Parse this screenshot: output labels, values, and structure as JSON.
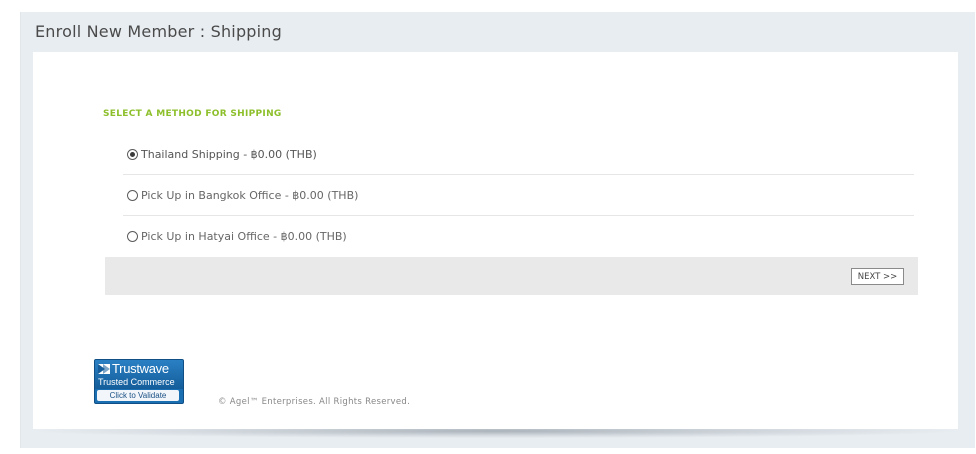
{
  "header": {
    "title": "Enroll New Member : Shipping"
  },
  "shipping": {
    "heading": "SELECT A METHOD FOR SHIPPING",
    "options": [
      {
        "label": "Thailand Shipping - ฿0.00 (THB)",
        "selected": true
      },
      {
        "label": "Pick Up in Bangkok Office - ฿0.00 (THB)",
        "selected": false
      },
      {
        "label": "Pick Up in Hatyai Office - ฿0.00 (THB)",
        "selected": false
      }
    ],
    "next_label": "NEXT >>"
  },
  "trust_badge": {
    "name": "Trustwave",
    "subtitle": "Trusted Commerce",
    "validate_label": "Click to Validate"
  },
  "footer": {
    "copyright": "© Agel™ Enterprises. All Rights Reserved."
  },
  "colors": {
    "heading_green": "#8cbf2a",
    "badge_blue": "#1a6fb3",
    "page_bg": "#e8edf1"
  }
}
